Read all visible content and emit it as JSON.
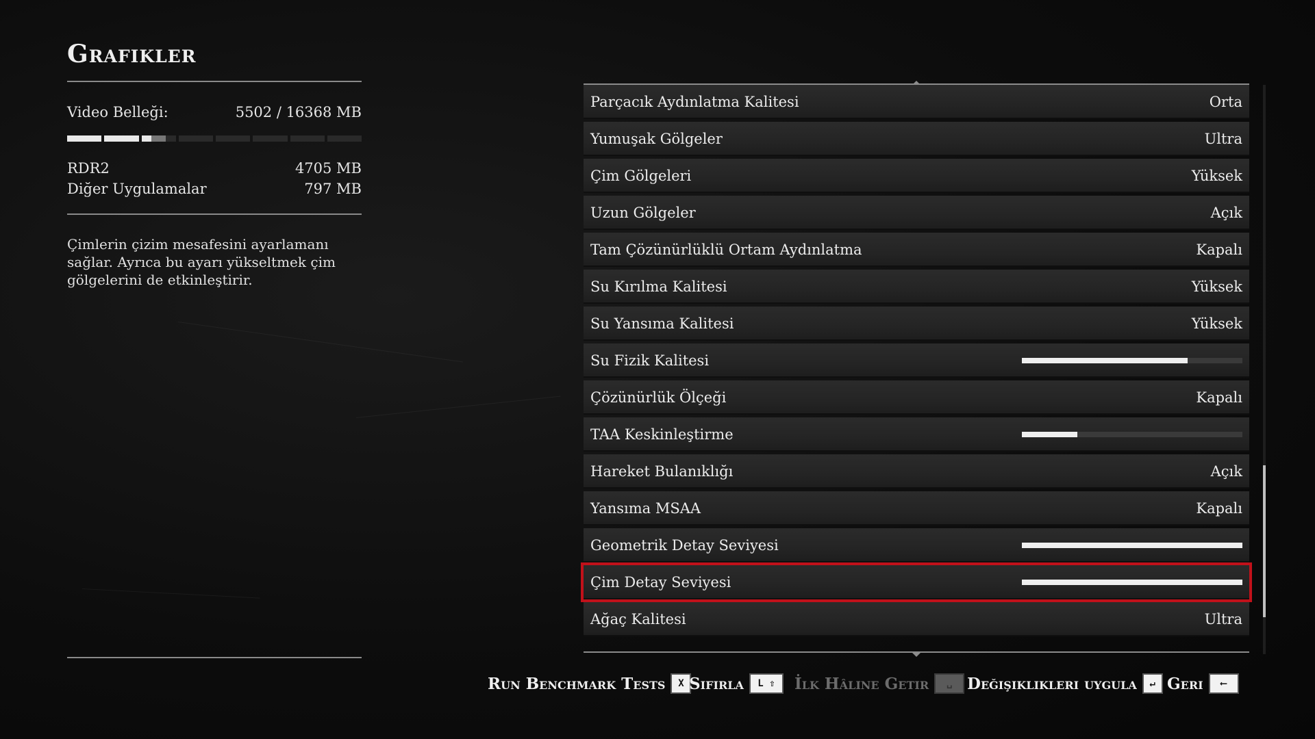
{
  "page": {
    "title": "Grafikler"
  },
  "memory": {
    "label": "Video Belleği:",
    "value": "5502 / 16368 MB",
    "bar_fill_fraction": 0.336,
    "rows": [
      {
        "label": "RDR2",
        "value": "4705 MB"
      },
      {
        "label": "Diğer Uygulamalar",
        "value": "797 MB"
      }
    ]
  },
  "description": "Çimlerin çizim mesafesini ayarlamanı sağlar. Ayrıca bu ayarı yükseltmek çim gölgelerini de etkinleştirir.",
  "settings": [
    {
      "name": "Parçacık Aydınlatma Kalitesi",
      "type": "text",
      "value": "Orta"
    },
    {
      "name": "Yumuşak Gölgeler",
      "type": "text",
      "value": "Ultra"
    },
    {
      "name": "Çim Gölgeleri",
      "type": "text",
      "value": "Yüksek"
    },
    {
      "name": "Uzun Gölgeler",
      "type": "text",
      "value": "Açık"
    },
    {
      "name": "Tam Çözünürlüklü Ortam Aydınlatma",
      "type": "text",
      "value": "Kapalı"
    },
    {
      "name": "Su Kırılma Kalitesi",
      "type": "text",
      "value": "Yüksek"
    },
    {
      "name": "Su Yansıma Kalitesi",
      "type": "text",
      "value": "Yüksek"
    },
    {
      "name": "Su Fizik Kalitesi",
      "type": "slider",
      "fraction": 0.75
    },
    {
      "name": "Çözünürlük Ölçeği",
      "type": "text",
      "value": "Kapalı"
    },
    {
      "name": "TAA Keskinleştirme",
      "type": "slider",
      "fraction": 0.25
    },
    {
      "name": "Hareket Bulanıklığı",
      "type": "text",
      "value": "Açık"
    },
    {
      "name": "Yansıma MSAA",
      "type": "text",
      "value": "Kapalı"
    },
    {
      "name": "Geometrik Detay Seviyesi",
      "type": "slider",
      "fraction": 1.0
    },
    {
      "name": "Çim Detay Seviyesi",
      "type": "slider",
      "fraction": 1.0,
      "selected": true
    },
    {
      "name": "Ağaç Kalitesi",
      "type": "text",
      "value": "Ultra"
    }
  ],
  "footer": {
    "benchmark": {
      "label": "Run Benchmark Tests",
      "key": "X"
    },
    "reset": {
      "label": "Sıfırla",
      "key": "L ⇧"
    },
    "restore": {
      "label": "İlk Hâline Getir",
      "key": "␣"
    },
    "apply": {
      "label": "Değişiklikleri uygula",
      "key": "↵"
    },
    "back": {
      "label": "Geri",
      "key": "⟵"
    }
  },
  "colors": {
    "highlight": "#c1111a",
    "text": "#ececec",
    "row_bg": "#262626"
  }
}
